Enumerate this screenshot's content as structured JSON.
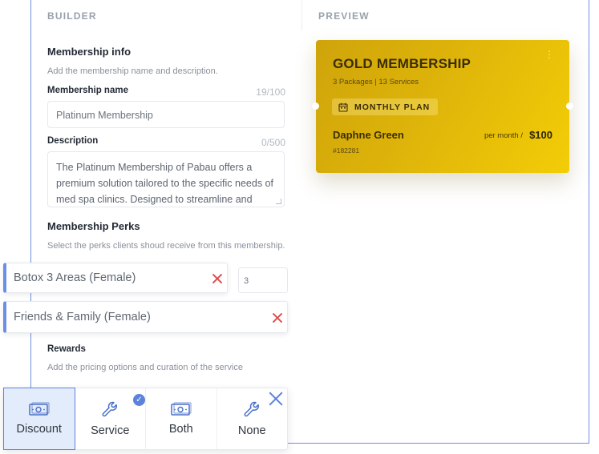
{
  "tabs": {
    "builder": "BUILDER",
    "preview": "PREVIEW"
  },
  "membership_info": {
    "title": "Membership info",
    "subtitle": "Add the membership name and description.",
    "name_label": "Membership name",
    "name_counter": "19/100",
    "name_value": "Platinum Membership",
    "description_label": "Description",
    "description_counter": "0/500",
    "description_value": "The Platinum Membership of Pabau offers a premium solution tailored to the specific needs of med spa clinics. Designed to streamline and"
  },
  "perks": {
    "title": "Membership Perks",
    "subtitle": "Select the perks clients shoud receive from this membership.",
    "items": [
      {
        "label": "Botox 3 Areas (Female)",
        "quantity": "3"
      },
      {
        "label": "Friends & Family (Female)"
      }
    ]
  },
  "rewards": {
    "title": "Rewards",
    "subtitle": "Add the pricing options and curation of the service",
    "options": [
      {
        "label": "Discount",
        "icon": "money-icon",
        "selected": true
      },
      {
        "label": "Service",
        "icon": "wrench-icon",
        "checked": true
      },
      {
        "label": "Both",
        "icon": "money-icon"
      },
      {
        "label": "None",
        "icon": "wrench-icon"
      }
    ],
    "check_mark": "✓"
  },
  "preview_card": {
    "title": "GOLD MEMBERSHIP",
    "subtitle": "3 Packages | 13 Services",
    "plan": "MONTHLY PLAN",
    "holder": "Daphne Green",
    "holder_id": "#182281",
    "per_month": "per month /",
    "price": "$100",
    "menu_dots": "⋮",
    "colors": {
      "gradient_start": "#cfa40b",
      "gradient_end": "#f3cd07"
    }
  },
  "colors": {
    "accent": "#5c82dc",
    "remove": "#e04c4c"
  }
}
